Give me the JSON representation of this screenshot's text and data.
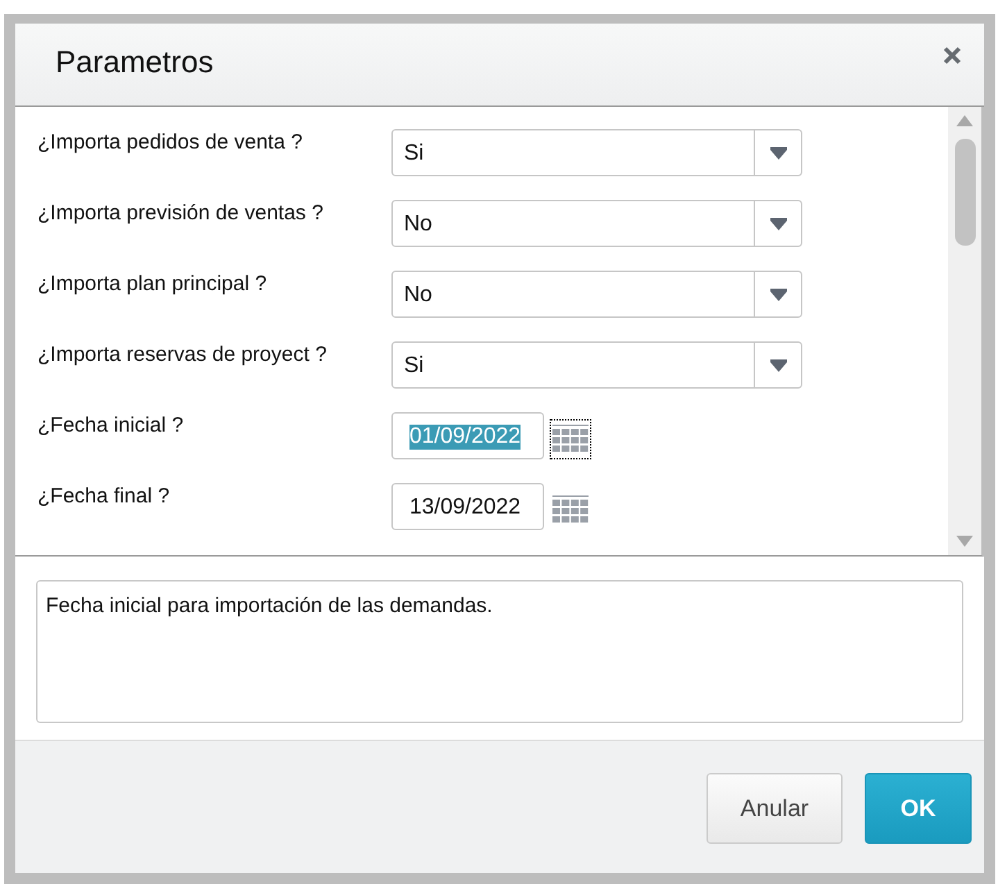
{
  "dialog": {
    "title": "Parametros"
  },
  "parameters": [
    {
      "kind": "select",
      "label": "¿Importa pedidos de venta ?",
      "value": "Si"
    },
    {
      "kind": "select",
      "label": "¿Importa previsión de ventas ?",
      "value": "No"
    },
    {
      "kind": "select",
      "label": "¿Importa plan principal ?",
      "value": "No"
    },
    {
      "kind": "select",
      "label": "¿Importa reservas de proyect ?",
      "value": "Si"
    },
    {
      "kind": "date",
      "label": "¿Fecha inicial ?",
      "value": "01/09/2022",
      "highlighted": true,
      "calendar_focused": true
    },
    {
      "kind": "date",
      "label": "¿Fecha final ?",
      "value": "13/09/2022",
      "highlighted": false,
      "calendar_focused": false
    }
  ],
  "description": "Fecha inicial para importación de las demandas.",
  "buttons": [
    {
      "kind": "secondary",
      "label": "Anular"
    },
    {
      "kind": "primary",
      "label": "OK"
    }
  ]
}
